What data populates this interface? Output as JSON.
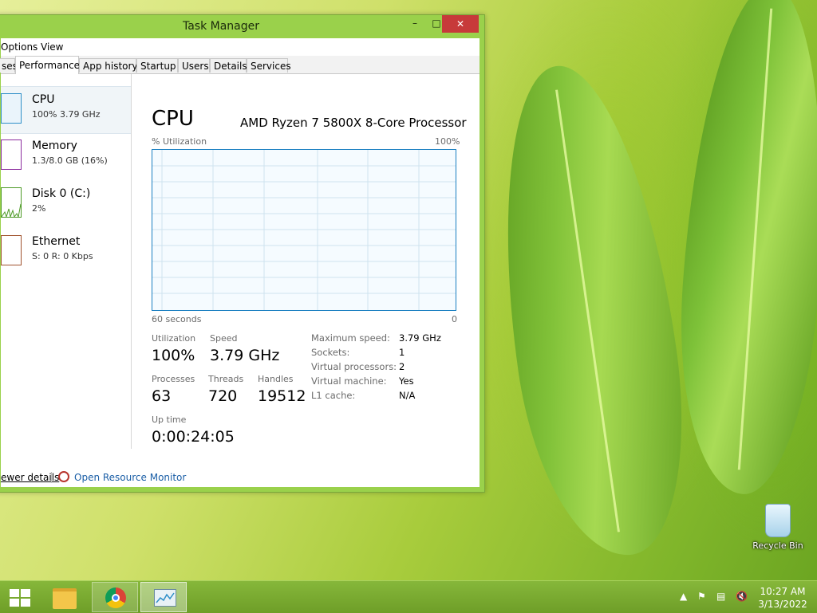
{
  "window": {
    "title": "Task Manager",
    "min_glyph": "▭",
    "max_glyph": "□",
    "close_glyph": "✕"
  },
  "menu": [
    "Options",
    "View"
  ],
  "tabs": [
    "ses",
    "Performance",
    "App history",
    "Startup",
    "Users",
    "Details",
    "Services"
  ],
  "active_tab": "Performance",
  "sidebar": [
    {
      "name": "CPU",
      "sub": "100% 3.79 GHz",
      "color": "#2f8fc8"
    },
    {
      "name": "Memory",
      "sub": "1.3/8.0 GB (16%)",
      "color": "#8b2c9e"
    },
    {
      "name": "Disk 0 (C:)",
      "sub": "2%",
      "color": "#4d9a26"
    },
    {
      "name": "Ethernet",
      "sub": "S: 0 R: 0 Kbps",
      "color": "#a0522d"
    }
  ],
  "cpu": {
    "title": "CPU",
    "processor": "AMD Ryzen 7 5800X 8-Core Processor",
    "util_label": "% Utilization",
    "util_max": "100%",
    "time_label": "60 seconds",
    "time_min": "0",
    "utilization_label": "Utilization",
    "utilization": "100%",
    "speed_label": "Speed",
    "speed": "3.79 GHz",
    "processes_label": "Processes",
    "processes": "63",
    "threads_label": "Threads",
    "threads": "720",
    "handles_label": "Handles",
    "handles": "19512",
    "uptime_label": "Up time",
    "uptime": "0:00:24:05",
    "specs": [
      {
        "key": "Maximum speed:",
        "value": "3.79 GHz"
      },
      {
        "key": "Sockets:",
        "value": "1"
      },
      {
        "key": "Virtual processors:",
        "value": "2"
      },
      {
        "key": "Virtual machine:",
        "value": "Yes"
      },
      {
        "key": "L1 cache:",
        "value": "N/A"
      }
    ]
  },
  "footer": {
    "fewer": "ewer details",
    "resource_monitor": "Open Resource Monitor"
  },
  "desktop": {
    "recycle_bin": "Recycle Bin"
  },
  "taskbar": {
    "time": "10:27 AM",
    "date": "3/13/2022"
  }
}
